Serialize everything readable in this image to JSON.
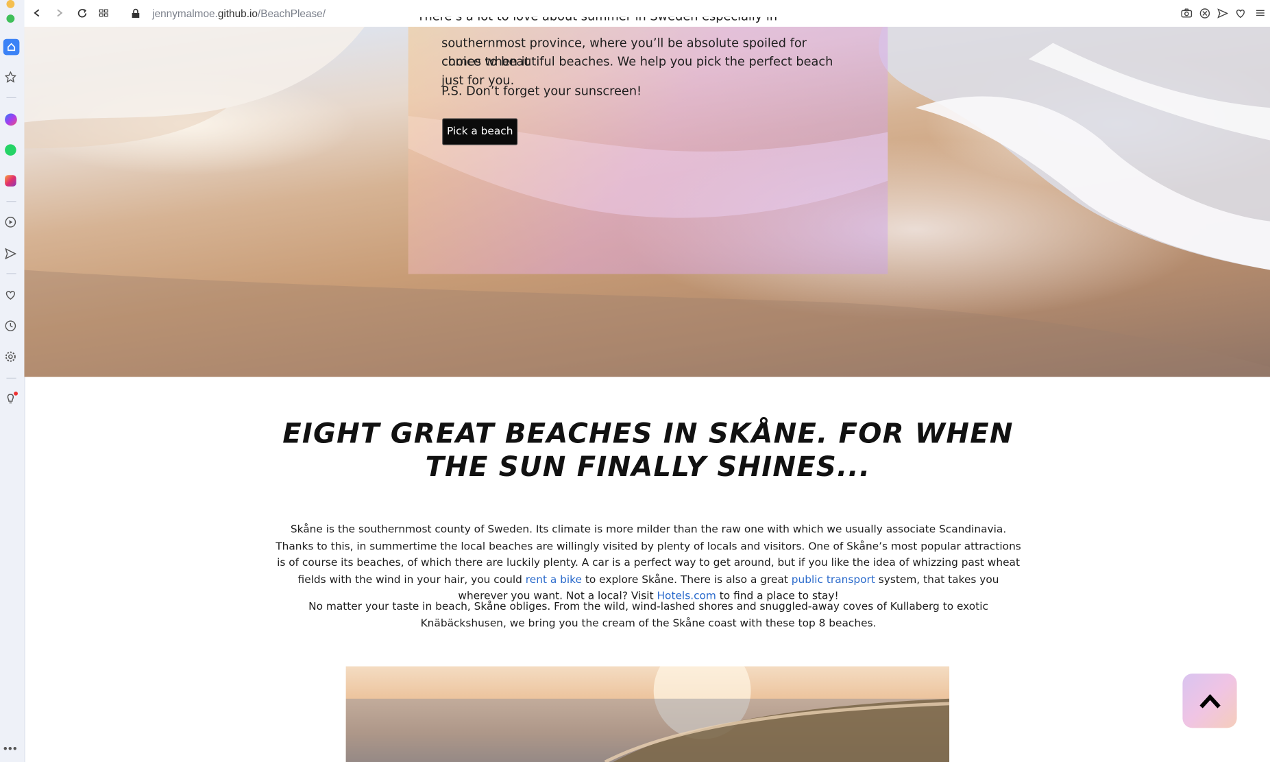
{
  "browser": {
    "url_prefix": "jennymalmoe.",
    "url_host": "github.io",
    "url_path": "/BeachPlease/",
    "icons": [
      "back-icon",
      "forward-icon",
      "reload-icon",
      "tabs-grid-icon",
      "lock-icon",
      "camera-icon",
      "adblock-icon",
      "send-icon",
      "heart-icon",
      "menu-icon"
    ]
  },
  "sidebar": {
    "items": [
      "home-icon",
      "bookmark-icon",
      "messenger-icon",
      "whatsapp-icon",
      "instagram-icon",
      "player-icon",
      "send-icon",
      "heart-icon",
      "history-icon",
      "settings-icon",
      "tips-icon",
      "more-icon"
    ],
    "colors": {
      "messenger": "#8a4df5",
      "whatsapp": "#25d366",
      "instagram": "#e1306c",
      "home": "#3b82f6"
    }
  },
  "hero": {
    "intro_line_cut": "There’s a lot to love about summer in Sweden especially in Skåne, Sweden’s",
    "intro_line2": "southernmost province, where you’ll be absolute spoiled for choice when it",
    "intro_line3": "comes to beautiful beaches. We help you pick the perfect beach just for you.",
    "ps": "P.S. Don’t forget your sunscreen!",
    "button_label": "Pick a beach"
  },
  "main": {
    "heading": "Eight great beaches in Skåne. For when the sun finally shines...",
    "p1_a": "Skåne is the southernmost county of Sweden. Its climate is more milder than the raw one with which we usually associate Scandinavia. Thanks to this, in summertime the local beaches are willingly visited by plenty of locals and visitors. One of Skåne’s most popular attractions is of course its beaches, of which there are luckily plenty. A car is a perfect way to get around, but if you like the idea of whizzing past wheat fields with the wind in your hair, you could ",
    "link_bike": "rent a bike",
    "p1_b": " to explore Skåne. There is also a great ",
    "link_transport": "public transport",
    "p1_c": " system, that takes you wherever you want. Not a local? Visit ",
    "link_hotels": "Hotels.com",
    "p1_d": " to find a place to stay!",
    "p2": "No matter your taste in beach, Skåne obliges. From the wild, wind-lashed shores and snuggled-away coves of Kullaberg to exotic Knäbäckshusen, we bring you the cream of the Skåne coast with these top 8 beaches."
  },
  "scroll_top": {
    "icon": "chevron-up-icon"
  }
}
